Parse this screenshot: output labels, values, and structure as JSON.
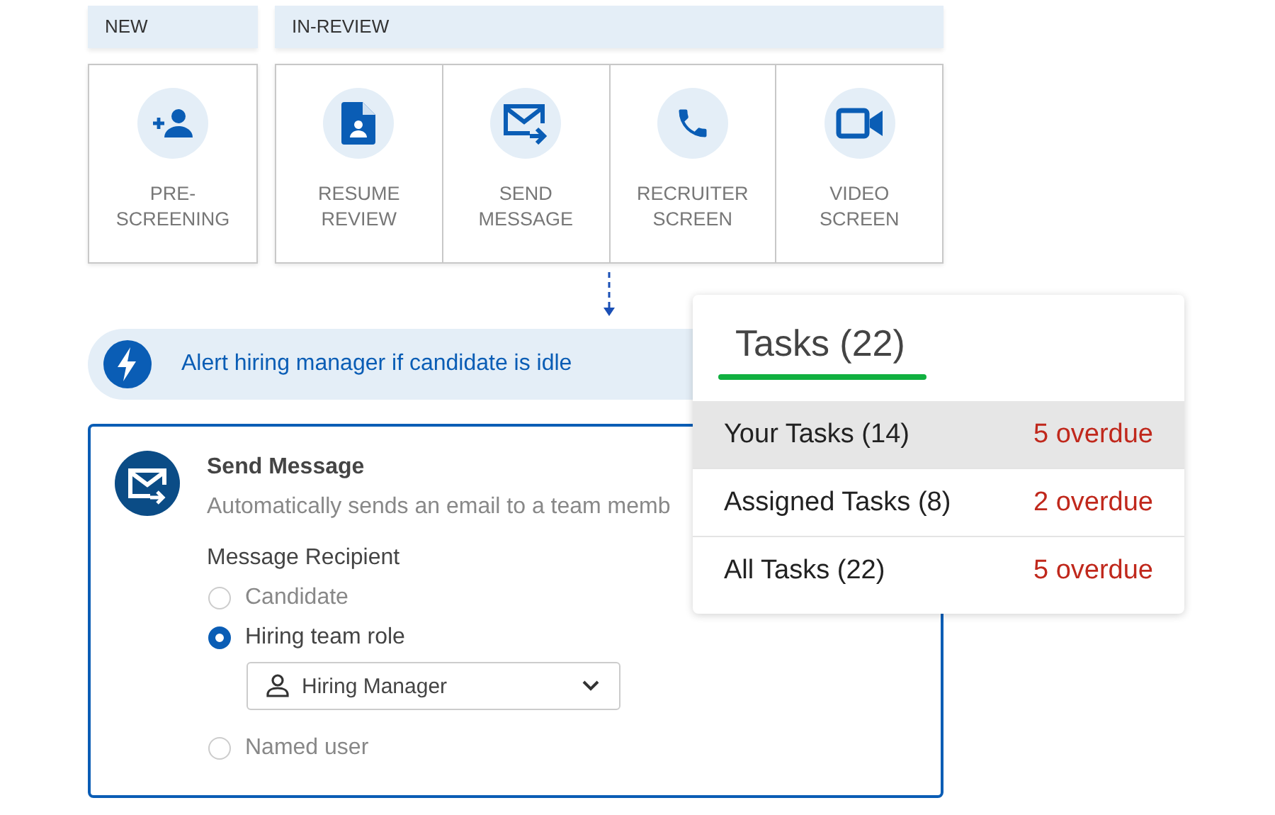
{
  "stage_groups": [
    {
      "label": "NEW",
      "stages": [
        {
          "kind": "add-person",
          "label": "PRE-\nSCREENING"
        }
      ]
    },
    {
      "label": "IN-REVIEW",
      "stages": [
        {
          "kind": "document",
          "label": "RESUME\nREVIEW"
        },
        {
          "kind": "mail-send",
          "label": "SEND\nMESSAGE"
        },
        {
          "kind": "phone",
          "label": "RECRUITER\nSCREEN"
        },
        {
          "kind": "video",
          "label": "VIDEO\nSCREEN"
        }
      ]
    }
  ],
  "alert": {
    "text": "Alert hiring manager if candidate is idle"
  },
  "action_card": {
    "title": "Send Message",
    "description": "Automatically sends an email to a team memb",
    "recipient_label": "Message Recipient",
    "options": [
      {
        "label": "Candidate",
        "selected": false
      },
      {
        "label": "Hiring team role",
        "selected": true
      },
      {
        "label": "Named user",
        "selected": false
      }
    ],
    "role_select": {
      "value": "Hiring Manager"
    }
  },
  "tasks_panel": {
    "title": "Tasks (22)",
    "rows": [
      {
        "label": "Your Tasks (14)",
        "overdue": "5 overdue",
        "selected": true
      },
      {
        "label": "Assigned Tasks (8)",
        "overdue": "2 overdue",
        "selected": false
      },
      {
        "label": "All Tasks (22)",
        "overdue": "5 overdue",
        "selected": false
      }
    ]
  }
}
